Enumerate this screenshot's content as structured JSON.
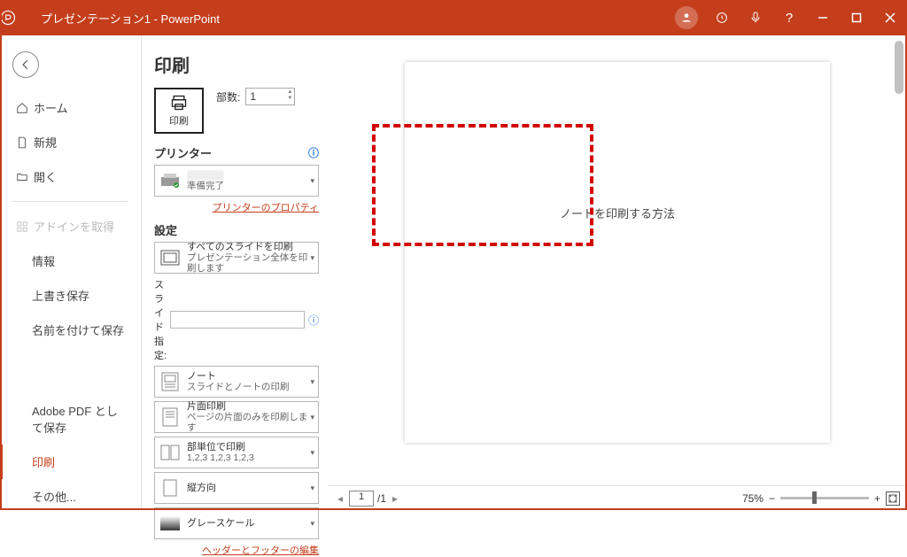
{
  "header": {
    "title": "プレゼンテーション1  -  PowerPoint"
  },
  "nav": {
    "items": [
      {
        "icon": "home",
        "label": "ホーム"
      },
      {
        "icon": "doc",
        "label": "新規"
      },
      {
        "icon": "open",
        "label": "開く"
      }
    ],
    "addins": "アドインを取得",
    "sub_items": [
      "情報",
      "上書き保存",
      "名前を付けて保存"
    ],
    "adobe": "Adobe PDF として保存",
    "print": "印刷",
    "other": "その他..."
  },
  "center": {
    "heading": "印刷",
    "print_label": "印刷",
    "copies_label": "部数:",
    "copies_value": "1",
    "printer_heading": "プリンター",
    "printer_status": "準備完了",
    "printer_props": "プリンターのプロパティ",
    "settings_heading": "設定",
    "combo1": {
      "main": "すべてのスライドを印刷",
      "sub": "プレゼンテーション全体を印刷します"
    },
    "slide_spec_label": "スライド指定:",
    "combo2": {
      "main": "ノート",
      "sub": "スライドとノートの印刷"
    },
    "combo3": {
      "main": "片面印刷",
      "sub": "ページの片面のみを印刷します"
    },
    "combo4": {
      "main": "部単位で印刷",
      "sub": "1,2,3   1,2,3   1,2,3"
    },
    "combo5": {
      "main": "縦方向",
      "sub": ""
    },
    "combo6": {
      "main": "グレースケール",
      "sub": ""
    },
    "footer_link": "ヘッダーとフッターの編集"
  },
  "preview": {
    "slide_text": "ノートを印刷する方法",
    "page_current": "1",
    "page_total": "/1",
    "zoom": "75%"
  }
}
